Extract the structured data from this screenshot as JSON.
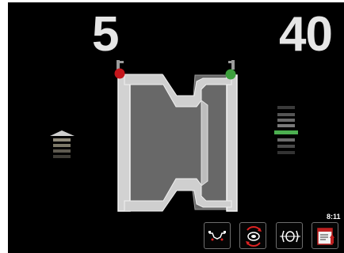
{
  "balance": {
    "left_weight": "5",
    "right_weight": "40"
  },
  "status": {
    "clock": "8:11"
  },
  "indicators": {
    "left": {
      "direction": "up",
      "level_bars": 4
    },
    "right": {
      "highlight_bar": 4,
      "total_bars": 8,
      "highlight_color": "#4caf50"
    }
  },
  "clamps": {
    "left_color": "#c4161c",
    "right_color": "#3c9f3c"
  },
  "toolbar": {
    "buttons": [
      {
        "icon": "rim-profile-icon"
      },
      {
        "icon": "wheel-rotate-icon"
      },
      {
        "icon": "wheel-view-icon"
      },
      {
        "icon": "data-menu-icon"
      }
    ]
  }
}
